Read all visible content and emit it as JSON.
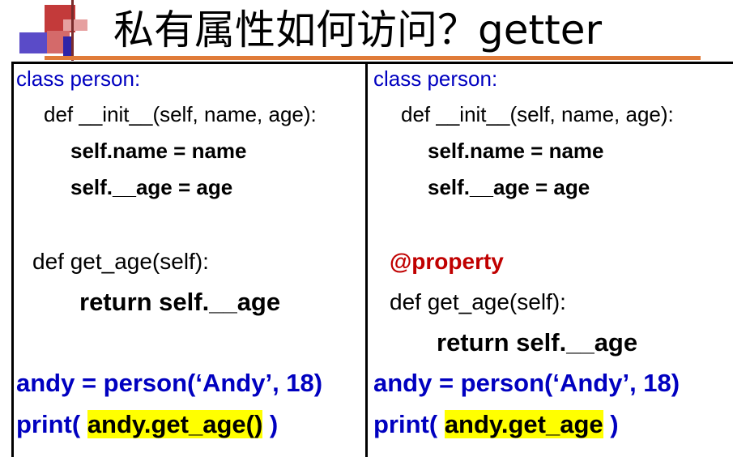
{
  "title": "私有属性如何访问？getter",
  "left_code": {
    "class_line": "class person:",
    "init_line": "def __init__(self, name, age):",
    "name_line": "self.name = name",
    "age_line": "self.__age = age",
    "def_line": "def get_age(self):",
    "return_line": "return self.__age",
    "andy_line": "andy = person(‘Andy’, 18)",
    "print_open": "print( ",
    "print_call": "andy.get_age()",
    "print_close": " )"
  },
  "right_code": {
    "class_line": "class person:",
    "init_line": "def __init__(self, name, age):",
    "name_line": "self.name = name",
    "age_line": "self.__age = age",
    "decorator_line": "@property",
    "def_line": "def get_age(self):",
    "return_line": "return self.__age",
    "andy_line": "andy = person(‘Andy’, 18)",
    "print_open": "print( ",
    "print_call": "andy.get_age",
    "print_close": " )"
  },
  "colors": {
    "keyword_blue": "#0000c0",
    "decorator_red": "#c00000",
    "highlight": "#ffff00",
    "title_rule": "#e07b39"
  }
}
